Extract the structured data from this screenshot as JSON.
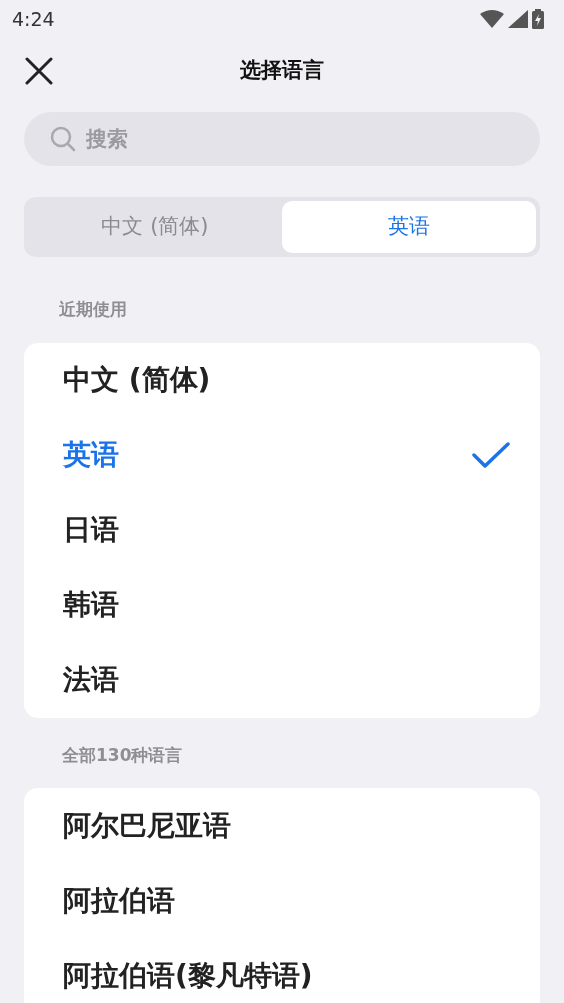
{
  "status_bar": {
    "time": "4:24"
  },
  "header": {
    "title": "选择语言"
  },
  "search": {
    "placeholder": "搜索"
  },
  "tabs": [
    {
      "label": "中文 (简体)",
      "selected": false
    },
    {
      "label": "英语",
      "selected": true
    }
  ],
  "sections": [
    {
      "title": "近期使用",
      "items": [
        {
          "label": "中文 (简体)",
          "selected": false
        },
        {
          "label": "英语",
          "selected": true
        },
        {
          "label": "日语",
          "selected": false
        },
        {
          "label": "韩语",
          "selected": false
        },
        {
          "label": "法语",
          "selected": false
        }
      ]
    },
    {
      "title": "全部130种语言",
      "items": [
        {
          "label": "阿尔巴尼亚语",
          "selected": false
        },
        {
          "label": "阿拉伯语",
          "selected": false
        },
        {
          "label": "阿拉伯语(黎凡特语)",
          "selected": false
        }
      ]
    }
  ]
}
